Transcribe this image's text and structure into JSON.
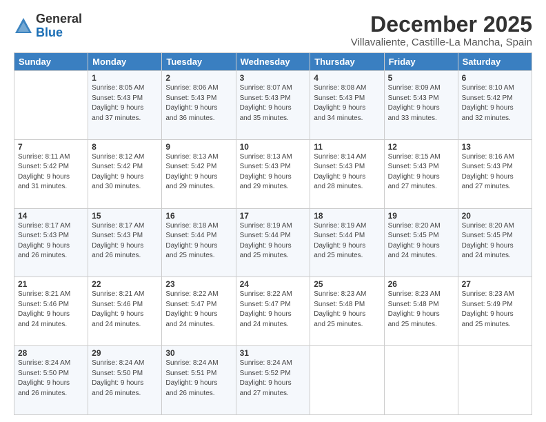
{
  "logo": {
    "general": "General",
    "blue": "Blue"
  },
  "title": "December 2025",
  "subtitle": "Villavaliente, Castille-La Mancha, Spain",
  "headers": [
    "Sunday",
    "Monday",
    "Tuesday",
    "Wednesday",
    "Thursday",
    "Friday",
    "Saturday"
  ],
  "weeks": [
    [
      {
        "day": "",
        "sunrise": "",
        "sunset": "",
        "daylight": ""
      },
      {
        "day": "1",
        "sunrise": "Sunrise: 8:05 AM",
        "sunset": "Sunset: 5:43 PM",
        "daylight": "Daylight: 9 hours and 37 minutes."
      },
      {
        "day": "2",
        "sunrise": "Sunrise: 8:06 AM",
        "sunset": "Sunset: 5:43 PM",
        "daylight": "Daylight: 9 hours and 36 minutes."
      },
      {
        "day": "3",
        "sunrise": "Sunrise: 8:07 AM",
        "sunset": "Sunset: 5:43 PM",
        "daylight": "Daylight: 9 hours and 35 minutes."
      },
      {
        "day": "4",
        "sunrise": "Sunrise: 8:08 AM",
        "sunset": "Sunset: 5:43 PM",
        "daylight": "Daylight: 9 hours and 34 minutes."
      },
      {
        "day": "5",
        "sunrise": "Sunrise: 8:09 AM",
        "sunset": "Sunset: 5:43 PM",
        "daylight": "Daylight: 9 hours and 33 minutes."
      },
      {
        "day": "6",
        "sunrise": "Sunrise: 8:10 AM",
        "sunset": "Sunset: 5:42 PM",
        "daylight": "Daylight: 9 hours and 32 minutes."
      }
    ],
    [
      {
        "day": "7",
        "sunrise": "Sunrise: 8:11 AM",
        "sunset": "Sunset: 5:42 PM",
        "daylight": "Daylight: 9 hours and 31 minutes."
      },
      {
        "day": "8",
        "sunrise": "Sunrise: 8:12 AM",
        "sunset": "Sunset: 5:42 PM",
        "daylight": "Daylight: 9 hours and 30 minutes."
      },
      {
        "day": "9",
        "sunrise": "Sunrise: 8:13 AM",
        "sunset": "Sunset: 5:42 PM",
        "daylight": "Daylight: 9 hours and 29 minutes."
      },
      {
        "day": "10",
        "sunrise": "Sunrise: 8:13 AM",
        "sunset": "Sunset: 5:43 PM",
        "daylight": "Daylight: 9 hours and 29 minutes."
      },
      {
        "day": "11",
        "sunrise": "Sunrise: 8:14 AM",
        "sunset": "Sunset: 5:43 PM",
        "daylight": "Daylight: 9 hours and 28 minutes."
      },
      {
        "day": "12",
        "sunrise": "Sunrise: 8:15 AM",
        "sunset": "Sunset: 5:43 PM",
        "daylight": "Daylight: 9 hours and 27 minutes."
      },
      {
        "day": "13",
        "sunrise": "Sunrise: 8:16 AM",
        "sunset": "Sunset: 5:43 PM",
        "daylight": "Daylight: 9 hours and 27 minutes."
      }
    ],
    [
      {
        "day": "14",
        "sunrise": "Sunrise: 8:17 AM",
        "sunset": "Sunset: 5:43 PM",
        "daylight": "Daylight: 9 hours and 26 minutes."
      },
      {
        "day": "15",
        "sunrise": "Sunrise: 8:17 AM",
        "sunset": "Sunset: 5:43 PM",
        "daylight": "Daylight: 9 hours and 26 minutes."
      },
      {
        "day": "16",
        "sunrise": "Sunrise: 8:18 AM",
        "sunset": "Sunset: 5:44 PM",
        "daylight": "Daylight: 9 hours and 25 minutes."
      },
      {
        "day": "17",
        "sunrise": "Sunrise: 8:19 AM",
        "sunset": "Sunset: 5:44 PM",
        "daylight": "Daylight: 9 hours and 25 minutes."
      },
      {
        "day": "18",
        "sunrise": "Sunrise: 8:19 AM",
        "sunset": "Sunset: 5:44 PM",
        "daylight": "Daylight: 9 hours and 25 minutes."
      },
      {
        "day": "19",
        "sunrise": "Sunrise: 8:20 AM",
        "sunset": "Sunset: 5:45 PM",
        "daylight": "Daylight: 9 hours and 24 minutes."
      },
      {
        "day": "20",
        "sunrise": "Sunrise: 8:20 AM",
        "sunset": "Sunset: 5:45 PM",
        "daylight": "Daylight: 9 hours and 24 minutes."
      }
    ],
    [
      {
        "day": "21",
        "sunrise": "Sunrise: 8:21 AM",
        "sunset": "Sunset: 5:46 PM",
        "daylight": "Daylight: 9 hours and 24 minutes."
      },
      {
        "day": "22",
        "sunrise": "Sunrise: 8:21 AM",
        "sunset": "Sunset: 5:46 PM",
        "daylight": "Daylight: 9 hours and 24 minutes."
      },
      {
        "day": "23",
        "sunrise": "Sunrise: 8:22 AM",
        "sunset": "Sunset: 5:47 PM",
        "daylight": "Daylight: 9 hours and 24 minutes."
      },
      {
        "day": "24",
        "sunrise": "Sunrise: 8:22 AM",
        "sunset": "Sunset: 5:47 PM",
        "daylight": "Daylight: 9 hours and 24 minutes."
      },
      {
        "day": "25",
        "sunrise": "Sunrise: 8:23 AM",
        "sunset": "Sunset: 5:48 PM",
        "daylight": "Daylight: 9 hours and 25 minutes."
      },
      {
        "day": "26",
        "sunrise": "Sunrise: 8:23 AM",
        "sunset": "Sunset: 5:48 PM",
        "daylight": "Daylight: 9 hours and 25 minutes."
      },
      {
        "day": "27",
        "sunrise": "Sunrise: 8:23 AM",
        "sunset": "Sunset: 5:49 PM",
        "daylight": "Daylight: 9 hours and 25 minutes."
      }
    ],
    [
      {
        "day": "28",
        "sunrise": "Sunrise: 8:24 AM",
        "sunset": "Sunset: 5:50 PM",
        "daylight": "Daylight: 9 hours and 26 minutes."
      },
      {
        "day": "29",
        "sunrise": "Sunrise: 8:24 AM",
        "sunset": "Sunset: 5:50 PM",
        "daylight": "Daylight: 9 hours and 26 minutes."
      },
      {
        "day": "30",
        "sunrise": "Sunrise: 8:24 AM",
        "sunset": "Sunset: 5:51 PM",
        "daylight": "Daylight: 9 hours and 26 minutes."
      },
      {
        "day": "31",
        "sunrise": "Sunrise: 8:24 AM",
        "sunset": "Sunset: 5:52 PM",
        "daylight": "Daylight: 9 hours and 27 minutes."
      },
      {
        "day": "",
        "sunrise": "",
        "sunset": "",
        "daylight": ""
      },
      {
        "day": "",
        "sunrise": "",
        "sunset": "",
        "daylight": ""
      },
      {
        "day": "",
        "sunrise": "",
        "sunset": "",
        "daylight": ""
      }
    ]
  ]
}
